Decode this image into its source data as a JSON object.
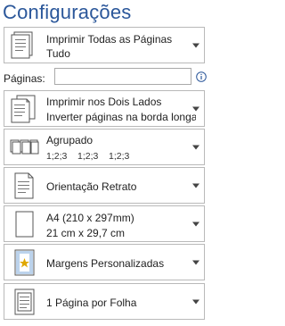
{
  "title": "Configurações",
  "options": {
    "print_scope": {
      "line1": "Imprimir Todas as Páginas",
      "line2": "Tudo"
    },
    "pages": {
      "label": "Páginas:",
      "value": "",
      "info_icon": "info-icon"
    },
    "duplex": {
      "line1": "Imprimir nos Dois Lados",
      "line2": "Inverter páginas na borda longa"
    },
    "collation": {
      "line1": "Agrupado",
      "line2": "1;2;3    1;2;3    1;2;3"
    },
    "orientation": {
      "line1": "Orientação Retrato"
    },
    "paper_size": {
      "line1": "A4 (210 x 297mm)",
      "line2": "21 cm x 29,7 cm"
    },
    "margins": {
      "line1": "Margens Personalizadas"
    },
    "pages_per_sheet": {
      "line1": "1 Página por Folha"
    }
  },
  "colors": {
    "title": "#2b579a",
    "border": "#b9b9b9",
    "margin_star": "#e0a800",
    "margin_band": "#bcd3ec"
  }
}
